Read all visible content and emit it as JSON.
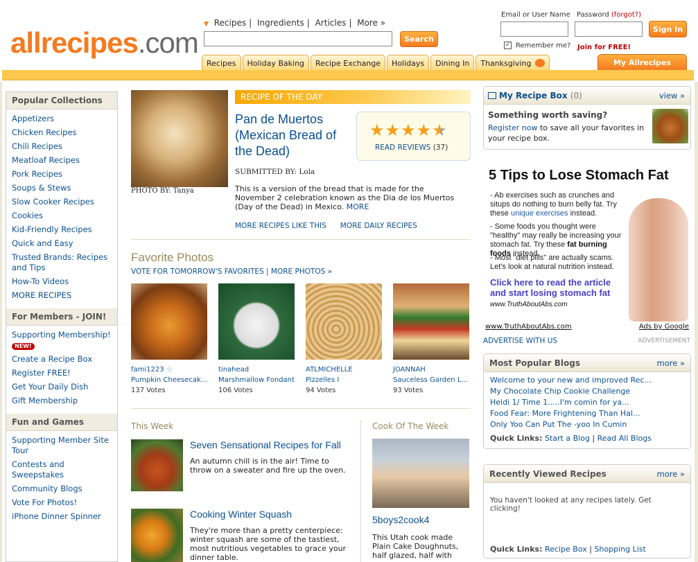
{
  "header": {
    "logo_main": "allrecipes",
    "logo_dot": ".com",
    "search_tabs": [
      "Recipes",
      "Ingredients",
      "Articles",
      "More »"
    ],
    "search_button": "Search",
    "email_label": "Email or User Name",
    "password_label": "Password",
    "forgot_label": "(forgot?)",
    "signin_button": "Sign In",
    "remember_label": "Remember me?",
    "join_label": "Join for FREE!",
    "nav_tabs": [
      "Recipes",
      "Holiday Baking",
      "Recipe Exchange",
      "Holidays",
      "Dining In",
      "Thanksgiving"
    ],
    "my_allrecipes": "My Allrecipes",
    "brand_color": "#f47b20"
  },
  "sidebar": {
    "popular_title": "Popular Collections",
    "popular": [
      "Appetizers",
      "Chicken Recipes",
      "Chili Recipes",
      "Meatloaf Recipes",
      "Pork Recipes",
      "Soups & Stews",
      "Slow Cooker Recipes",
      "Cookies",
      "Kid-Friendly Recipes",
      "Quick and Easy",
      "Trusted Brands: Recipes and Tips",
      "How-To Videos",
      "MORE RECIPES"
    ],
    "members_title": "For Members - JOIN!",
    "members_first": "Supporting Membership!",
    "new_badge": "NEW!",
    "members": [
      "Create a Recipe Box",
      "Register FREE!",
      "Get Your Daily Dish",
      "Gift Membership"
    ],
    "fun_title": "Fun and Games",
    "fun": [
      "Supporting Member Site Tour",
      "Contests and Sweepstakes",
      "Community Blogs",
      "Vote For Photos!",
      "iPhone Dinner Spinner"
    ]
  },
  "rotd": {
    "band": "RECIPE OF THE DAY",
    "photo_credit": "PHOTO BY: Tanya",
    "title": "Pan de Muertos (Mexican Bread of the Dead)",
    "stars": "★★★★",
    "half_star": "★",
    "read_reviews": "READ REVIEWS",
    "review_count": "(37)",
    "submitted": "SUBMITTED BY: Lola",
    "description": "This is a version of the bread that is made for the November 2 celebration known as the Dia de los Muertos (Day of the Dead) in Mexico.",
    "more": "MORE",
    "more_like": "MORE RECIPES LIKE THIS",
    "more_daily": "MORE DAILY RECIPES"
  },
  "favorites": {
    "title": "Favorite Photos",
    "vote": "VOTE FOR TOMORROW'S FAVORITES",
    "more_photos": "MORE PHOTOS »",
    "photos": [
      {
        "user": "fami1223",
        "recipe": "Pumpkin Cheesecak...",
        "votes": "137 Votes"
      },
      {
        "user": "tinahead",
        "recipe": "Marshmallow Fondant",
        "votes": "106 Votes"
      },
      {
        "user": "ATLMICHELLE",
        "recipe": "Pizzelles I",
        "votes": "94 Votes"
      },
      {
        "user": "JOANNAH",
        "recipe": "Sauceless Garden L...",
        "votes": "93 Votes"
      }
    ]
  },
  "this_week": {
    "heading": "This Week",
    "items": [
      {
        "title": "Seven Sensational Recipes for Fall",
        "desc": "An autumn chill is in the air! Time to throw on a sweater and fire up the oven."
      },
      {
        "title": "Cooking Winter Squash",
        "desc": "They're more than a pretty centerpiece: winter squash are some of the tastiest, most nutritious vegetables to grace your dinner table."
      }
    ]
  },
  "cook": {
    "heading": "Cook Of The Week",
    "name": "5boys2cook4",
    "desc": "This Utah cook made Plain Cake Doughnuts, half glazed, half with"
  },
  "recipe_box": {
    "title": "My Recipe Box",
    "count": "(0)",
    "view": "view »",
    "headline": "Something worth saving?",
    "register": "Register now",
    "text": "to save all your favorites in your recipe box."
  },
  "ad": {
    "title": "5 Tips to Lose Stomach Fat",
    "p1a": "- Ab exercises such as crunches and situps do nothing to burn belly fat. Try these ",
    "p1link": "unique exercises",
    "p1b": " instead.",
    "p2a": "- Some foods you thought were \"healthy\" may really be increasing your stomach fat. Try these ",
    "p2link": "fat burning foods",
    "p2b": " instead.",
    "p3": "- Most \"diet pills\" are actually scams. Let's look at natural nutrition instead.",
    "cta": "Click here to read the article and start losing stomach fat",
    "url": "www.TruthAboutAbs.com",
    "foot_url": "www.TruthAboutAbs.com",
    "google": "Ads by Google",
    "advertise": "ADVERTISE WITH US",
    "label": "ADVERTISEMENT"
  },
  "blogs": {
    "title": "Most Popular Blogs",
    "more": "more »",
    "items": [
      "Welcome to your new and improved Rec...",
      "My Chocolate Chip Cookie Challenge",
      "Heidi 1/ Time 1.....I'm comin for ya...",
      "Food Fear: More Frightening Than Hal...",
      "Only Yoo Can Put The -yoo In Cumin"
    ],
    "quick_label": "Quick Links:",
    "quick": [
      "Start a Blog",
      "Read All Blogs"
    ]
  },
  "recent": {
    "title": "Recently Viewed Recipes",
    "more": "more »",
    "text": "You haven't looked at any recipes lately. Get clicking!",
    "quick_label": "Quick Links:",
    "quick": [
      "Recipe Box",
      "Shopping List"
    ]
  }
}
